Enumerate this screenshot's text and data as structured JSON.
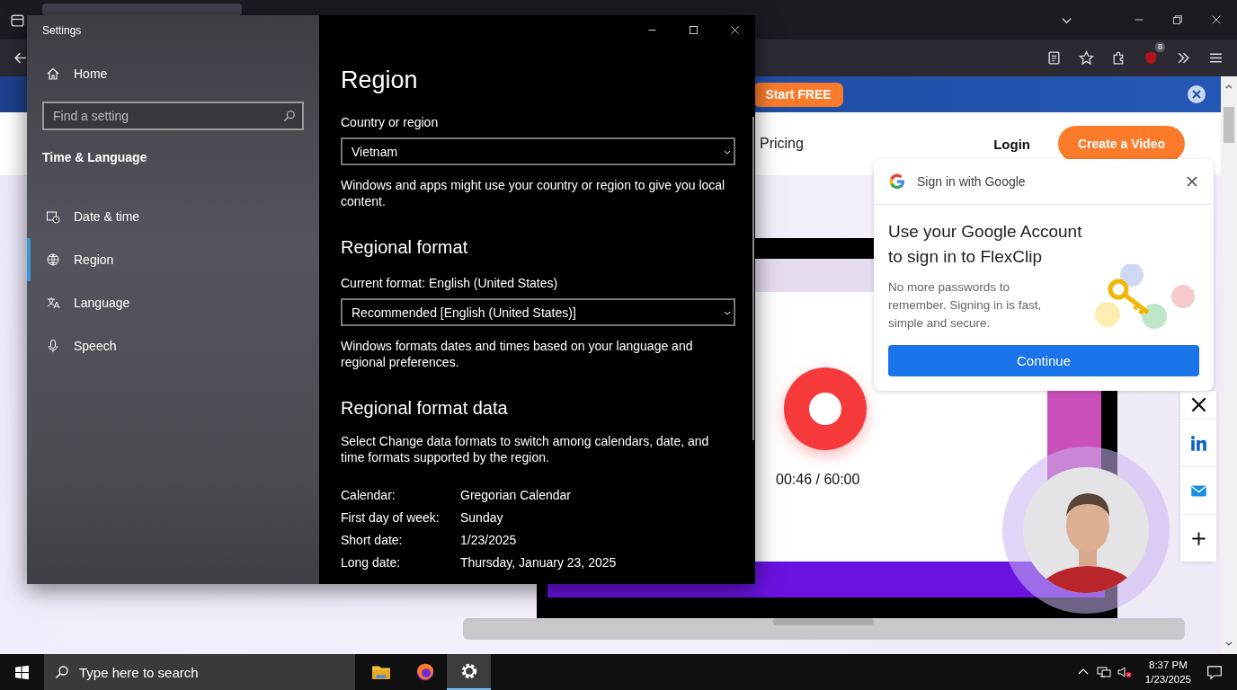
{
  "browser": {
    "extension_badge": "8",
    "banner": {
      "button": "Start FREE"
    },
    "nav": {
      "links": [
        "Pricing"
      ],
      "login": "Login",
      "cta": "Create a Video"
    },
    "recorder": {
      "timer": "00:46 / 60:00"
    },
    "share_buttons": [
      {
        "kind": "x"
      },
      {
        "kind": "linkedin"
      },
      {
        "kind": "mail"
      },
      {
        "kind": "more"
      }
    ],
    "google_popup": {
      "header": "Sign in with Google",
      "title": "Use your Google Account to sign in to FlexClip",
      "body": "No more passwords to remember. Signing in is fast, simple and secure.",
      "button": "Continue"
    }
  },
  "settings": {
    "window_title": "Settings",
    "home": "Home",
    "search": {
      "placeholder": "Find a setting"
    },
    "section": "Time & Language",
    "nav": [
      {
        "label": "Date & time",
        "kind": "clock",
        "selected": false
      },
      {
        "label": "Region",
        "kind": "globe",
        "selected": true
      },
      {
        "label": "Language",
        "kind": "language",
        "selected": false
      },
      {
        "label": "Speech",
        "kind": "mic",
        "selected": false
      }
    ],
    "page_title": "Region",
    "country": {
      "label": "Country or region",
      "value": "Vietnam",
      "description": "Windows and apps might use your country or region to give you local content."
    },
    "format": {
      "heading": "Regional format",
      "current": "Current format: English (United States)",
      "value": "Recommended [English (United States)]",
      "description": "Windows formats dates and times based on your language and regional preferences."
    },
    "format_data": {
      "heading": "Regional format data",
      "description": "Select Change data formats to switch among calendars, date, and time formats supported by the region.",
      "rows": [
        {
          "label": "Calendar:",
          "value": "Gregorian Calendar"
        },
        {
          "label": "First day of week:",
          "value": "Sunday"
        },
        {
          "label": "Short date:",
          "value": "1/23/2025"
        },
        {
          "label": "Long date:",
          "value": "Thursday, January 23, 2025"
        }
      ]
    }
  },
  "taskbar": {
    "search": {
      "placeholder": "Type here to search"
    },
    "apps": [
      {
        "kind": "explorer",
        "selected": false
      },
      {
        "kind": "firefox",
        "selected": false
      },
      {
        "kind": "settings",
        "selected": true
      }
    ],
    "time": "8:37 PM",
    "date": "1/23/2025"
  }
}
